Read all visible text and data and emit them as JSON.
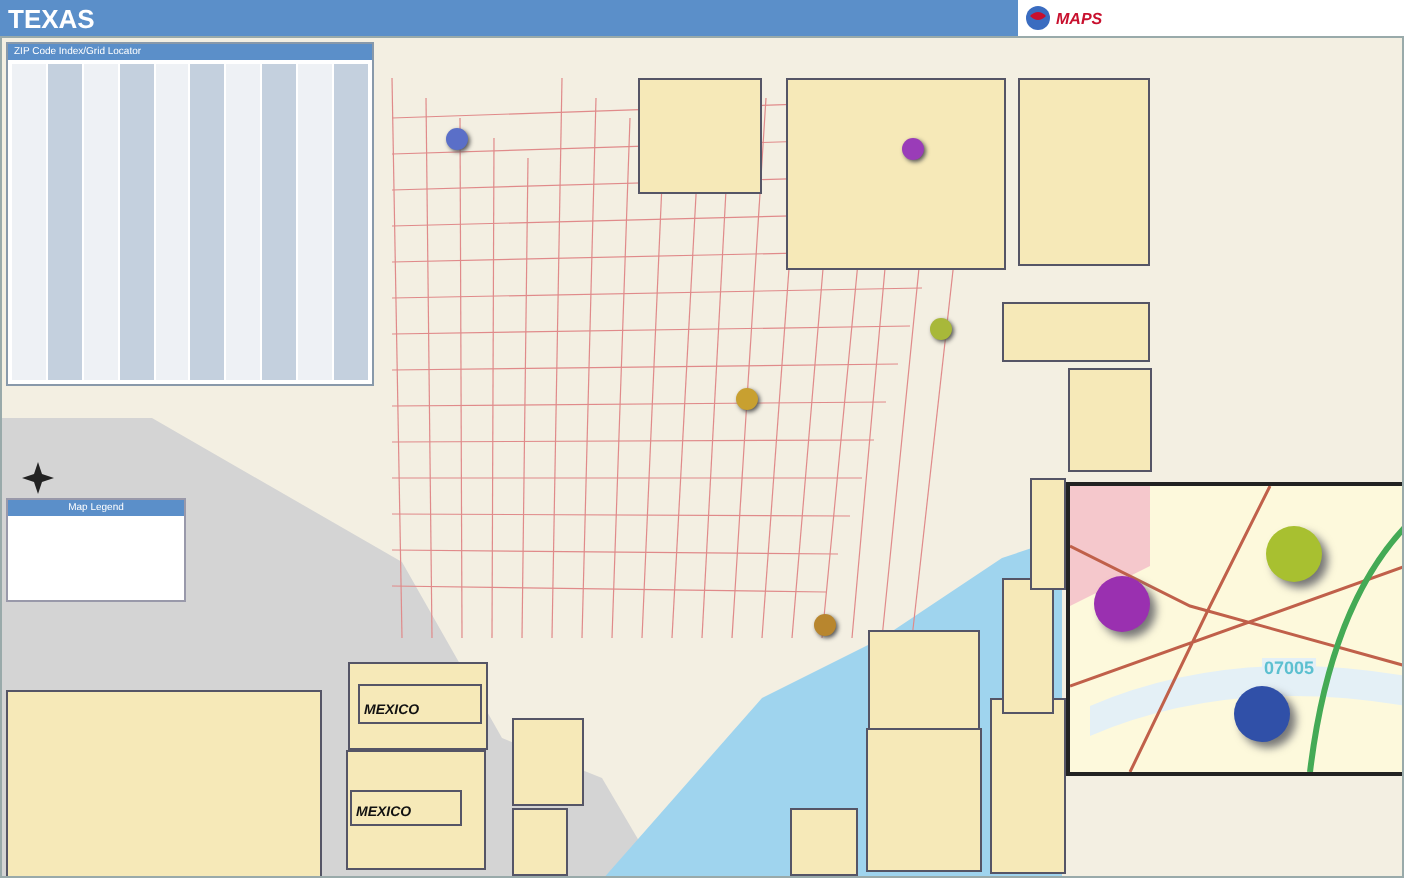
{
  "header": {
    "title": "TEXAS",
    "logo_text": "MAPS"
  },
  "zip_index": {
    "title": "ZIP Code Index/Grid Locator"
  },
  "legend": {
    "title": "Map Legend"
  },
  "insets": [
    {
      "label": "MEXICO"
    },
    {
      "label": "MEXICO"
    }
  ],
  "map_pins": [
    {
      "color": "#5a6fc8"
    },
    {
      "color": "#9a3cb8"
    },
    {
      "color": "#a8b83a"
    },
    {
      "color": "#c8a030"
    },
    {
      "color": "#b8862e"
    }
  ],
  "zoom_inset": {
    "zip_label": "07005",
    "pins": [
      {
        "color": "#a8c030"
      },
      {
        "color": "#9a30b0"
      },
      {
        "color": "#3050a8"
      }
    ]
  }
}
